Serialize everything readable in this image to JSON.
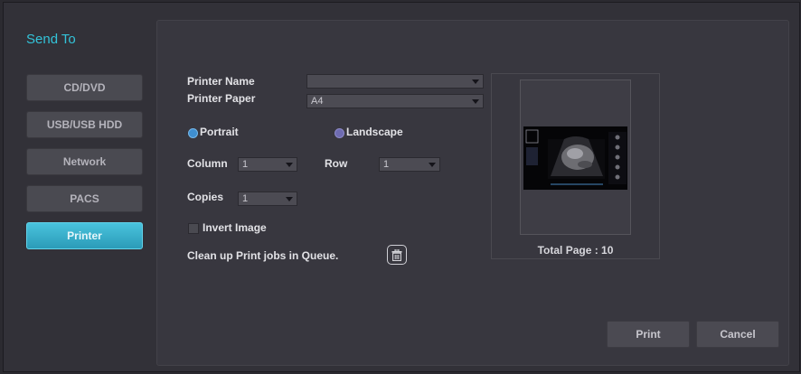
{
  "title": "Send To",
  "nav": [
    {
      "label": "CD/DVD"
    },
    {
      "label": "USB/USB HDD"
    },
    {
      "label": "Network"
    },
    {
      "label": "PACS"
    },
    {
      "label": "Printer",
      "active": true
    }
  ],
  "printer": {
    "name_label": "Printer Name",
    "name_value": "",
    "paper_label": "Printer Paper",
    "paper_value": "A4",
    "orientation": {
      "portrait_label": "Portrait",
      "landscape_label": "Landscape",
      "selected": "Portrait"
    },
    "column_label": "Column",
    "column_value": "1",
    "row_label": "Row",
    "row_value": "1",
    "copies_label": "Copies",
    "copies_value": "1",
    "invert_label": "Invert Image",
    "invert_checked": false,
    "cleanup_label": "Clean up Print jobs in Queue."
  },
  "preview": {
    "total_page": "Total Page : 10"
  },
  "actions": {
    "print_label": "Print",
    "cancel_label": "Cancel"
  },
  "colors": {
    "accent": "#33c3d9",
    "active_button": "#2fa6c2",
    "background": "#323138"
  },
  "icons": {
    "trash": "trash-icon",
    "dropdown": "chevron-down-icon"
  }
}
